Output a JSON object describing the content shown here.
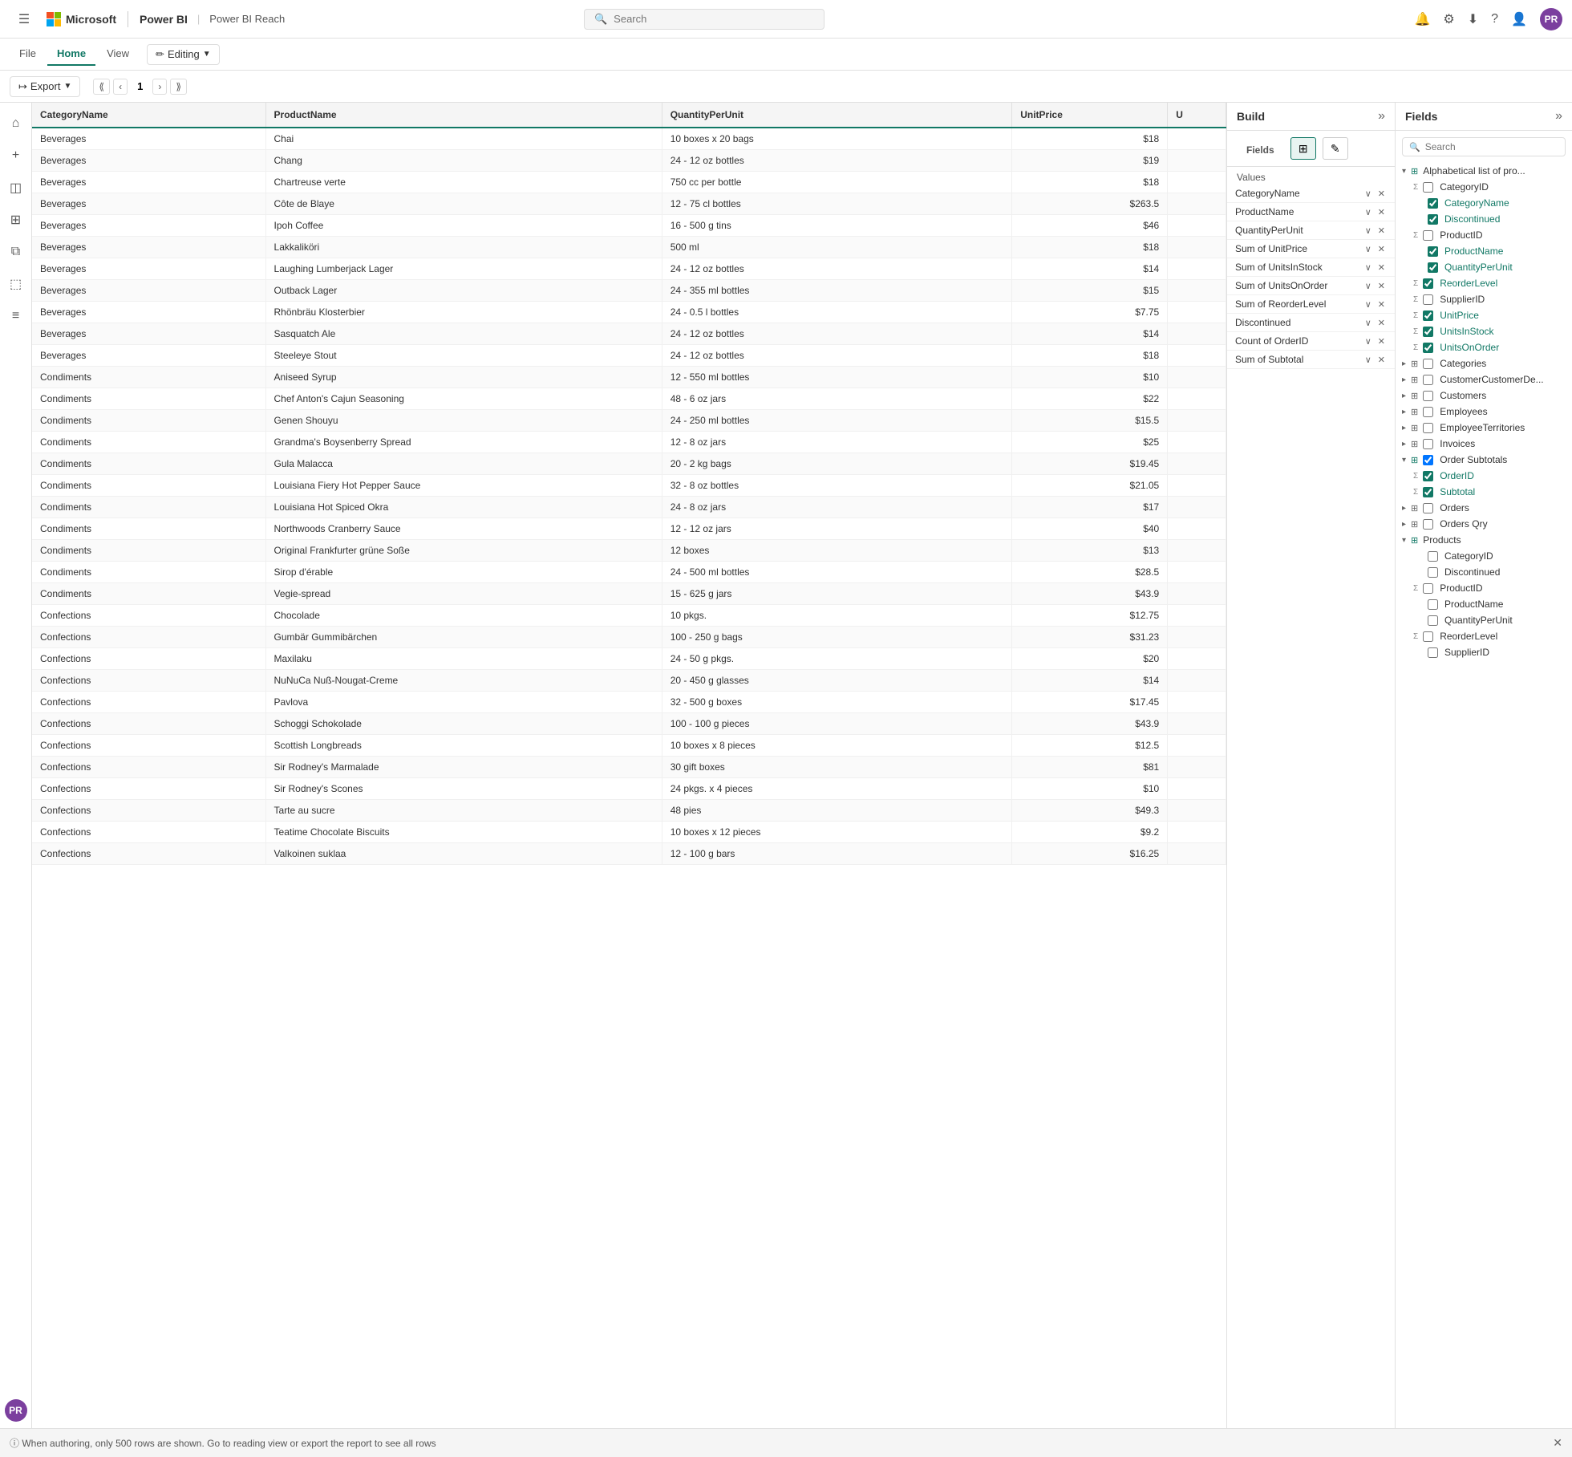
{
  "app": {
    "ms_text": "Microsoft",
    "powerbi_text": "Power BI",
    "reach_text": "Power BI Reach",
    "search_placeholder": "Search",
    "editing_label": "Editing",
    "avatar_initials": "PR"
  },
  "ribbon": {
    "tabs": [
      "File",
      "Home",
      "View"
    ],
    "active_tab": "Home"
  },
  "toolbar": {
    "export_label": "Export",
    "page_number": "1"
  },
  "table": {
    "columns": [
      "CategoryName",
      "ProductName",
      "QuantityPerUnit",
      "UnitPrice",
      "U"
    ],
    "rows": [
      [
        "Beverages",
        "Chai",
        "10 boxes x 20 bags",
        "$18",
        ""
      ],
      [
        "Beverages",
        "Chang",
        "24 - 12 oz bottles",
        "$19",
        ""
      ],
      [
        "Beverages",
        "Chartreuse verte",
        "750 cc per bottle",
        "$18",
        ""
      ],
      [
        "Beverages",
        "Côte de Blaye",
        "12 - 75 cl bottles",
        "$263.5",
        ""
      ],
      [
        "Beverages",
        "Ipoh Coffee",
        "16 - 500 g tins",
        "$46",
        ""
      ],
      [
        "Beverages",
        "Lakkaliköri",
        "500 ml",
        "$18",
        ""
      ],
      [
        "Beverages",
        "Laughing Lumberjack Lager",
        "24 - 12 oz bottles",
        "$14",
        ""
      ],
      [
        "Beverages",
        "Outback Lager",
        "24 - 355 ml bottles",
        "$15",
        ""
      ],
      [
        "Beverages",
        "Rhönbräu Klosterbier",
        "24 - 0.5 l bottles",
        "$7.75",
        ""
      ],
      [
        "Beverages",
        "Sasquatch Ale",
        "24 - 12 oz bottles",
        "$14",
        ""
      ],
      [
        "Beverages",
        "Steeleye Stout",
        "24 - 12 oz bottles",
        "$18",
        ""
      ],
      [
        "Condiments",
        "Aniseed Syrup",
        "12 - 550 ml bottles",
        "$10",
        ""
      ],
      [
        "Condiments",
        "Chef Anton's Cajun Seasoning",
        "48 - 6 oz jars",
        "$22",
        ""
      ],
      [
        "Condiments",
        "Genen Shouyu",
        "24 - 250 ml bottles",
        "$15.5",
        ""
      ],
      [
        "Condiments",
        "Grandma's Boysenberry Spread",
        "12 - 8 oz jars",
        "$25",
        ""
      ],
      [
        "Condiments",
        "Gula Malacca",
        "20 - 2 kg bags",
        "$19.45",
        ""
      ],
      [
        "Condiments",
        "Louisiana Fiery Hot Pepper Sauce",
        "32 - 8 oz bottles",
        "$21.05",
        ""
      ],
      [
        "Condiments",
        "Louisiana Hot Spiced Okra",
        "24 - 8 oz jars",
        "$17",
        ""
      ],
      [
        "Condiments",
        "Northwoods Cranberry Sauce",
        "12 - 12 oz jars",
        "$40",
        ""
      ],
      [
        "Condiments",
        "Original Frankfurter grüne Soße",
        "12 boxes",
        "$13",
        ""
      ],
      [
        "Condiments",
        "Sirop d'érable",
        "24 - 500 ml bottles",
        "$28.5",
        ""
      ],
      [
        "Condiments",
        "Vegie-spread",
        "15 - 625 g jars",
        "$43.9",
        ""
      ],
      [
        "Confections",
        "Chocolade",
        "10 pkgs.",
        "$12.75",
        ""
      ],
      [
        "Confections",
        "Gumbär Gummibärchen",
        "100 - 250 g bags",
        "$31.23",
        ""
      ],
      [
        "Confections",
        "Maxilaku",
        "24 - 50 g pkgs.",
        "$20",
        ""
      ],
      [
        "Confections",
        "NuNuCa Nuß-Nougat-Creme",
        "20 - 450 g glasses",
        "$14",
        ""
      ],
      [
        "Confections",
        "Pavlova",
        "32 - 500 g boxes",
        "$17.45",
        ""
      ],
      [
        "Confections",
        "Schoggi Schokolade",
        "100 - 100 g pieces",
        "$43.9",
        ""
      ],
      [
        "Confections",
        "Scottish Longbreads",
        "10 boxes x 8 pieces",
        "$12.5",
        ""
      ],
      [
        "Confections",
        "Sir Rodney's Marmalade",
        "30 gift boxes",
        "$81",
        ""
      ],
      [
        "Confections",
        "Sir Rodney's Scones",
        "24 pkgs. x 4 pieces",
        "$10",
        ""
      ],
      [
        "Confections",
        "Tarte au sucre",
        "48 pies",
        "$49.3",
        ""
      ],
      [
        "Confections",
        "Teatime Chocolate Biscuits",
        "10 boxes x 12 pieces",
        "$9.2",
        ""
      ],
      [
        "Confections",
        "Valkoinen suklaa",
        "12 - 100 g bars",
        "$16.25",
        ""
      ]
    ]
  },
  "build_panel": {
    "title": "Build",
    "expand_label": "»",
    "fields_label": "Fields",
    "values_label": "Values",
    "value_items": [
      "CategoryName",
      "ProductName",
      "QuantityPerUnit",
      "Sum of UnitPrice",
      "Sum of UnitsInStock",
      "Sum of UnitsOnOrder",
      "Sum of ReorderLevel",
      "Discontinued",
      "Count of OrderID",
      "Sum of Subtotal"
    ]
  },
  "fields_panel": {
    "title": "Fields",
    "expand_label": "»",
    "search_placeholder": "Search",
    "tree": [
      {
        "type": "group",
        "label": "Alphabetical list of pro...",
        "expanded": true,
        "children": [
          {
            "type": "field",
            "sigma": true,
            "checked": false,
            "label": "CategoryID"
          },
          {
            "type": "field",
            "sigma": false,
            "checked": true,
            "label": "CategoryName"
          },
          {
            "type": "field",
            "sigma": false,
            "checked": true,
            "label": "Discontinued"
          },
          {
            "type": "field",
            "sigma": true,
            "checked": false,
            "label": "ProductID"
          },
          {
            "type": "field",
            "sigma": false,
            "checked": true,
            "label": "ProductName"
          },
          {
            "type": "field",
            "sigma": false,
            "checked": true,
            "label": "QuantityPerUnit"
          },
          {
            "type": "field",
            "sigma": true,
            "checked": true,
            "label": "ReorderLevel"
          },
          {
            "type": "field",
            "sigma": true,
            "checked": false,
            "label": "SupplierID"
          },
          {
            "type": "field",
            "sigma": true,
            "checked": true,
            "label": "UnitPrice"
          },
          {
            "type": "field",
            "sigma": true,
            "checked": true,
            "label": "UnitsInStock"
          },
          {
            "type": "field",
            "sigma": true,
            "checked": true,
            "label": "UnitsOnOrder"
          }
        ]
      },
      {
        "type": "table",
        "label": "Categories",
        "expanded": false
      },
      {
        "type": "table",
        "label": "CustomerCustomerDe...",
        "expanded": false
      },
      {
        "type": "table",
        "label": "Customers",
        "expanded": false
      },
      {
        "type": "table",
        "label": "Employees",
        "expanded": false
      },
      {
        "type": "table",
        "label": "EmployeeTerritories",
        "expanded": false
      },
      {
        "type": "table",
        "label": "Invoices",
        "expanded": false
      },
      {
        "type": "group",
        "label": "Order Subtotals",
        "expanded": true,
        "checked": true,
        "children": [
          {
            "type": "field",
            "sigma": true,
            "checked": true,
            "label": "OrderID"
          },
          {
            "type": "field",
            "sigma": true,
            "checked": true,
            "label": "Subtotal"
          }
        ]
      },
      {
        "type": "table",
        "label": "Orders",
        "expanded": false
      },
      {
        "type": "table",
        "label": "Orders Qry",
        "expanded": false
      },
      {
        "type": "group",
        "label": "Products",
        "expanded": true,
        "children": [
          {
            "type": "field",
            "sigma": false,
            "checked": false,
            "label": "CategoryID"
          },
          {
            "type": "field",
            "sigma": false,
            "checked": false,
            "label": "Discontinued"
          },
          {
            "type": "field",
            "sigma": true,
            "checked": false,
            "label": "ProductID"
          },
          {
            "type": "field",
            "sigma": false,
            "checked": false,
            "label": "ProductName"
          },
          {
            "type": "field",
            "sigma": false,
            "checked": false,
            "label": "QuantityPerUnit"
          },
          {
            "type": "field",
            "sigma": true,
            "checked": false,
            "label": "ReorderLevel"
          },
          {
            "type": "field",
            "sigma": false,
            "checked": false,
            "label": "SupplierID"
          }
        ]
      }
    ]
  },
  "bottom_bar": {
    "message": "ⓘ  When authoring, only 500 rows are shown. Go to reading view or export the report to see all rows"
  },
  "left_sidebar": {
    "icons": [
      "☰",
      "⌂",
      "+",
      "◫",
      "⊞",
      "⧉",
      "⬚",
      "≡",
      "PR"
    ]
  }
}
